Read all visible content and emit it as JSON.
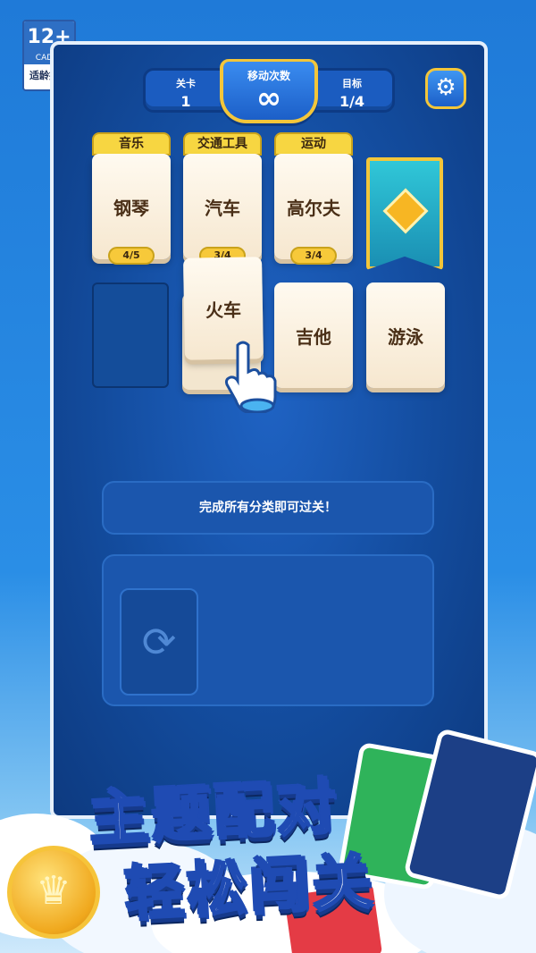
{
  "age_rating": {
    "number": "12+",
    "org": "CADPA",
    "tip": "适龄提示"
  },
  "hud": {
    "level_label": "关卡",
    "level_value": "1",
    "moves_label": "移动次数",
    "moves_value": "∞",
    "goal_label": "目标",
    "goal_value": "1/4",
    "settings_icon": "gear-icon"
  },
  "categories": [
    {
      "tab": "音乐",
      "card": "钢琴",
      "count": "4/5"
    },
    {
      "tab": "交通工具",
      "card": "汽车",
      "count": "3/4"
    },
    {
      "tab": "运动",
      "card": "高尔夫",
      "count": "3/4"
    }
  ],
  "board": {
    "dragged_card": "火车",
    "cards": [
      "吉他",
      "游泳"
    ],
    "locked_icon": "diamond-icon",
    "hand_icon": "pointer-hand-icon"
  },
  "hint": "完成所有分类即可过关！",
  "deck": {
    "icon": "refresh-icon"
  },
  "promo": {
    "line1": "主题配对",
    "line2": "轻松闯关",
    "coin_icon": "crown-icon"
  },
  "colors": {
    "accent_gold": "#f3c63a",
    "panel_blue": "#134c9e",
    "card_cream": "#fffaf0"
  }
}
